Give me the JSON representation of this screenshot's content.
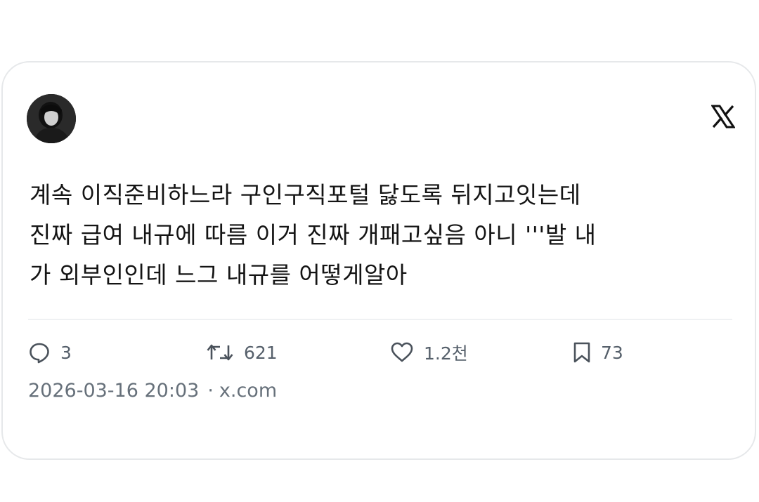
{
  "tweet": {
    "text": "계속 이직준비하느라 구인구직포털 닳도록 뒤지고잇는데\n진짜 급여 내규에 따름 이거 진짜 개패고싶음 아니 '''발 내\n가 외부인인데 느그 내규를 어떻게알아",
    "timestamp": "2026-03-16 20:03",
    "separator": "·",
    "source": "x.com"
  },
  "actions": {
    "replies": "3",
    "retweets": "621",
    "likes": "1.2천",
    "bookmarks": "73"
  },
  "icons": {
    "brand": "x-logo-icon",
    "reply": "reply-icon",
    "retweet": "retweet-icon",
    "like": "heart-icon",
    "bookmark": "bookmark-icon"
  },
  "colors": {
    "text": "#141414",
    "secondary": "#56606b",
    "border": "#e6e8ea"
  }
}
